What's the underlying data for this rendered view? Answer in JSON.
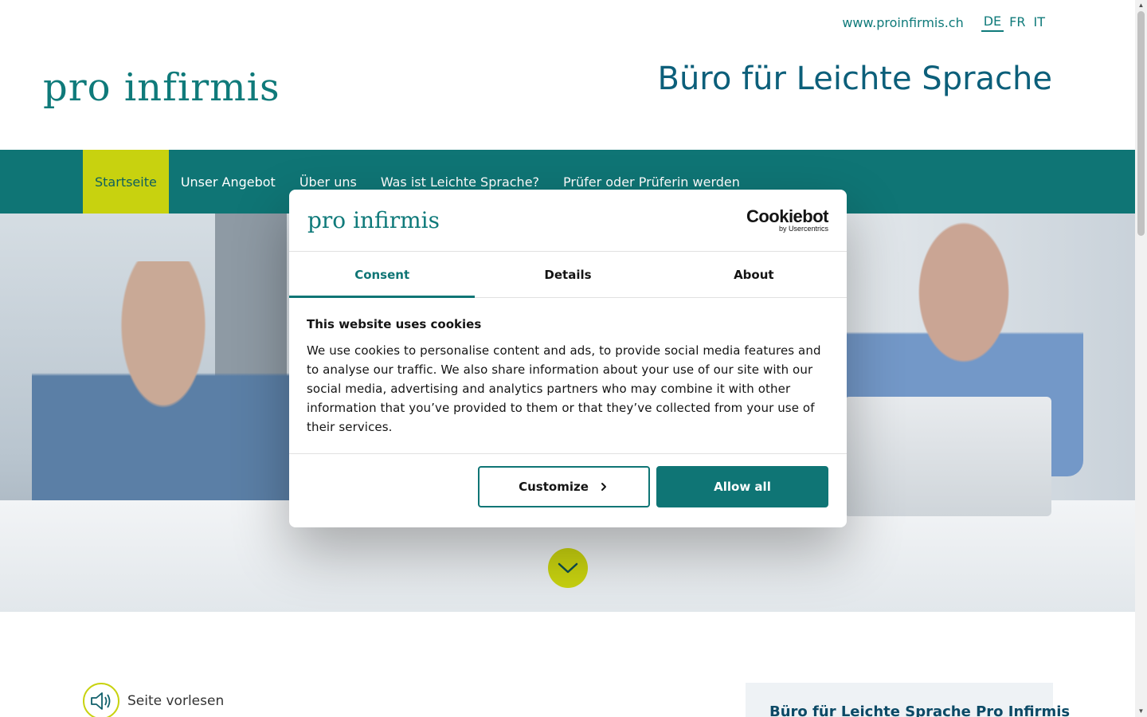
{
  "header": {
    "site_link": "www.proinfirmis.ch",
    "languages": [
      {
        "code": "DE",
        "active": true
      },
      {
        "code": "FR",
        "active": false
      },
      {
        "code": "IT",
        "active": false
      }
    ],
    "logo_text": "pro infirmis",
    "site_title": "Büro für Leichte Sprache"
  },
  "nav": {
    "items": [
      {
        "label": "Startseite",
        "active": true
      },
      {
        "label": "Unser Angebot",
        "active": false
      },
      {
        "label": "Über uns",
        "active": false
      },
      {
        "label": "Was ist Leichte Sprache?",
        "active": false
      },
      {
        "label": "Prüfer oder Prüferin werden",
        "active": false
      }
    ]
  },
  "hero": {
    "scroll_icon": "chevron-down-icon"
  },
  "content": {
    "read_aloud_label": "Seite vorlesen",
    "side_box_title": "Büro für Leichte Sprache Pro Infirmis"
  },
  "cookie_dialog": {
    "logo_text": "pro infirmis",
    "brand_big": "Cookiebot",
    "brand_small": "by Usercentrics",
    "tabs": [
      {
        "label": "Consent",
        "active": true
      },
      {
        "label": "Details",
        "active": false
      },
      {
        "label": "About",
        "active": false
      }
    ],
    "heading": "This website uses cookies",
    "text": "We use cookies to personalise content and ads, to provide social media features and to analyse our traffic. We also share information about your use of our site with our social media, advertising and analytics partners who may combine it with other information that you’ve provided to them or that they’ve collected from your use of their services.",
    "customize_label": "Customize",
    "allow_all_label": "Allow all"
  },
  "colors": {
    "brand_teal": "#0f7575",
    "accent_lime": "#c8d20f",
    "logo_dot": "#b0123f",
    "title_blue": "#0c5f7a"
  }
}
